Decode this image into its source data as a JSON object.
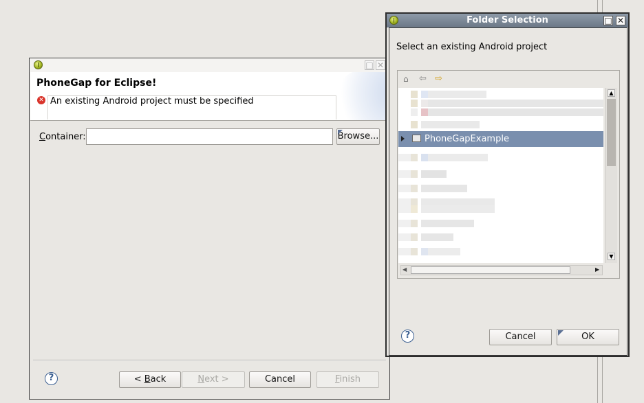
{
  "wizard": {
    "title": "PhoneGap for Eclipse!",
    "error": "An existing Android project must be specified",
    "container_label": "Container:",
    "container_value": "",
    "browse_label": "Browse...",
    "back_label": "< Back",
    "next_label": "Next >",
    "cancel_label": "Cancel",
    "finish_label": "Finish",
    "help_glyph": "?"
  },
  "folder_dialog": {
    "title": "Folder Selection",
    "message": "Select an existing Android project",
    "selected_item": "PhoneGapExample",
    "cancel_label": "Cancel",
    "ok_label": "OK",
    "help_glyph": "?"
  },
  "colors": {
    "selection": "#7a8fae",
    "title_active": "#7a8696",
    "error": "#d9342b"
  },
  "icons": [
    "app-icon",
    "error-icon",
    "help-icon",
    "home-icon",
    "back-arrow-icon",
    "forward-arrow-icon",
    "expand-icon",
    "project-icon",
    "maximize-icon",
    "close-icon"
  ]
}
